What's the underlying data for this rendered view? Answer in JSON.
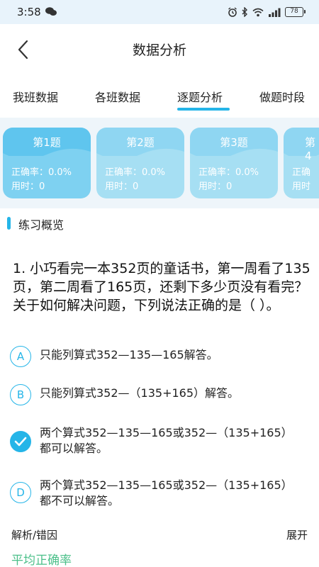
{
  "status": {
    "time": "3:58",
    "battery": "78"
  },
  "header": {
    "title": "数据分析"
  },
  "tabs": [
    {
      "label": "我班数据",
      "active": false
    },
    {
      "label": "各班数据",
      "active": false
    },
    {
      "label": "逐题分析",
      "active": true
    },
    {
      "label": "做题时段",
      "active": false
    }
  ],
  "question_cards": [
    {
      "title": "第1题",
      "accuracy": "正确率：0.0%",
      "time": "用时：0"
    },
    {
      "title": "第2题",
      "accuracy": "正确率：0.0%",
      "time": "用时：0"
    },
    {
      "title": "第3题",
      "accuracy": "正确率：0.0%",
      "time": "用时：0"
    },
    {
      "title": "第4",
      "accuracy": "正确",
      "time": "用时"
    }
  ],
  "section": {
    "title": "练习概览"
  },
  "question": {
    "text": "1. 小巧看完一本352页的童话书，第一周看了135页，第二周看了165页，还剩下多少页没有看完？关于如何解决问题，下列说法正确的是（ ）。"
  },
  "options": [
    {
      "letter": "A",
      "text": "只能列算式352—135—165解答。",
      "checked": false
    },
    {
      "letter": "B",
      "text": "只能列算式352—（135+165）解答。",
      "checked": false
    },
    {
      "letter": "C",
      "text": "两个算式352—135—165或352—（135+165）都可以解答。",
      "checked": true
    },
    {
      "letter": "D",
      "text": "两个算式352—135—165或352—（135+165）都不可以解答。",
      "checked": false
    }
  ],
  "analysis": {
    "label": "解析/错因",
    "expand": "展开"
  },
  "average": {
    "label": "平均正确率"
  },
  "colors": {
    "accent": "#25b5e8",
    "card_active": "#7ed1f1",
    "card_inactive": "#a6dff3",
    "green_text": "#4cc08a"
  }
}
